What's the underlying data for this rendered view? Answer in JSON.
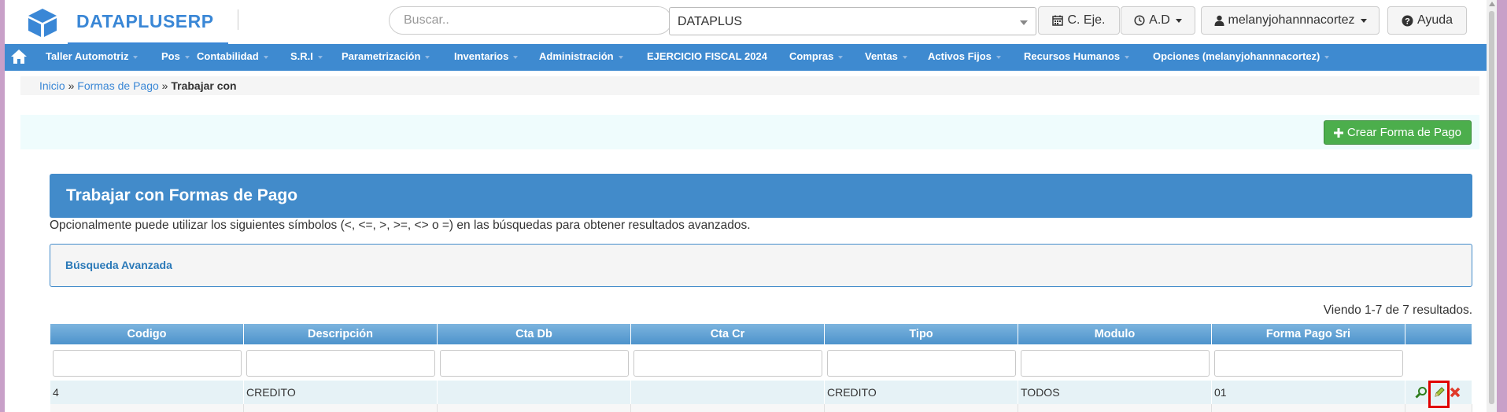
{
  "brand": {
    "name": "DATAPLUSERP"
  },
  "search": {
    "placeholder": "Buscar.."
  },
  "company": {
    "selected": "DATAPLUS"
  },
  "header_buttons": {
    "ejercicio": "C. Eje.",
    "ad": "A.D",
    "user": "melanyjohannnacortez",
    "help": "Ayuda"
  },
  "nav": {
    "items": [
      "Taller Automotriz",
      "Pos",
      "Contabilidad",
      "S.R.I",
      "Parametrización",
      "Inventarios",
      "Administración",
      "EJERCICIO FISCAL 2024",
      "Compras",
      "Ventas",
      "Activos Fijos",
      "Recursos Humanos",
      "Opciones (melanyjohannnacortez)"
    ]
  },
  "breadcrumb": {
    "home": "Inicio",
    "parent": "Formas de Pago",
    "current": "Trabajar con",
    "sep": "»"
  },
  "actions": {
    "create": "Crear Forma de Pago"
  },
  "panel": {
    "title": "Trabajar con Formas de Pago",
    "help": "Opcionalmente puede utilizar los siguientes símbolos (<, <=, >, >=, <> o =) en las búsquedas para obtener resultados avanzados.",
    "advanced": "Búsqueda Avanzada"
  },
  "grid": {
    "summary": "Viendo 1-7 de 7 resultados.",
    "columns": [
      "Codigo",
      "Descripción",
      "Cta Db",
      "Cta Cr",
      "Tipo",
      "Modulo",
      "Forma Pago Sri"
    ],
    "rows": [
      [
        "4",
        "CREDITO",
        "",
        "",
        "CREDITO",
        "TODOS",
        "01"
      ]
    ]
  },
  "colors": {
    "brand": "#3a87d6",
    "nav": "#3e8ad0",
    "panel": "#428bca",
    "create": "#4cae4c",
    "highlight": "#e10000"
  }
}
